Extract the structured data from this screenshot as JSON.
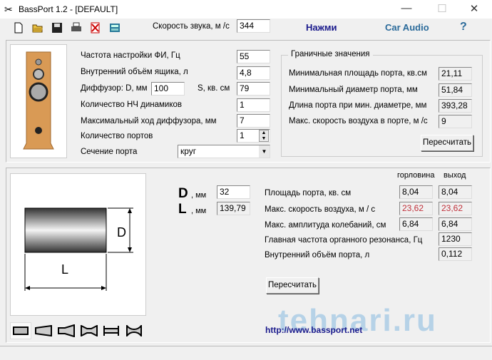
{
  "window": {
    "title": "BassPort 1.2 - [DEFAULT]",
    "min": "—",
    "max": "☐",
    "close": "✕"
  },
  "toolbar": {
    "sound_speed_label": "Скорость звука, м /с",
    "sound_speed_value": "344",
    "press_label": "Нажми",
    "car_audio_label": "Car Audio",
    "help_label": "?"
  },
  "params": {
    "tuning_freq": {
      "label": "Частота настройки ФИ, Гц",
      "value": "55"
    },
    "box_volume": {
      "label": "Внутренний объём ящика, л",
      "value": "4,8"
    },
    "diffuser": {
      "label": "Диффузор: D, мм",
      "d_value": "100",
      "s_label": "S, кв. см",
      "s_value": "79"
    },
    "woofer_count": {
      "label": "Количество НЧ динамиков",
      "value": "1"
    },
    "max_excursion": {
      "label": "Максимальный ход диффузора, мм",
      "value": "7"
    },
    "port_count": {
      "label": "Количество портов",
      "value": "1"
    },
    "port_section": {
      "label": "Сечение порта",
      "value": "круг"
    }
  },
  "limits": {
    "title": "Граничные значения",
    "rows": [
      {
        "label": "Минимальная площадь порта, кв.см",
        "value": "21,11"
      },
      {
        "label": "Минимальный диаметр порта, мм",
        "value": "51,84"
      },
      {
        "label": "Длина порта при мин. диаметре, мм",
        "value": "393,28"
      },
      {
        "label": "Макс. скорость воздуха в порте, м /с",
        "value": "9"
      }
    ],
    "recalc": "Пересчитать"
  },
  "port": {
    "d_letter": "D",
    "d_unit": ", мм",
    "d_value": "32",
    "l_letter": "L",
    "l_unit": ", мм",
    "l_value": "139,79",
    "diagram_d": "D",
    "diagram_l": "L"
  },
  "results": {
    "col_throat": "горловина",
    "col_exit": "выход",
    "rows": [
      {
        "label": "Площадь порта, кв. см",
        "throat": "8,04",
        "exit": "8,04"
      },
      {
        "label": "Макс. скорость воздуха, м / с",
        "throat": "23,62",
        "exit": "23,62"
      },
      {
        "label": "Макс. амплитуда колебаний, см",
        "throat": "6,84",
        "exit": "6,84"
      },
      {
        "label": "Главная частота органного резонанса, Гц",
        "exit": "1230"
      },
      {
        "label": "Внутренний объём порта, л",
        "exit": "0,112"
      }
    ],
    "recalc": "Пересчитать"
  },
  "url": "http://www.bassport.net",
  "watermark": "tehnari.ru",
  "colors": {
    "accent_blue": "#1a1a8c",
    "car_audio": "#2a6a9a",
    "alert": "#c0303a"
  }
}
